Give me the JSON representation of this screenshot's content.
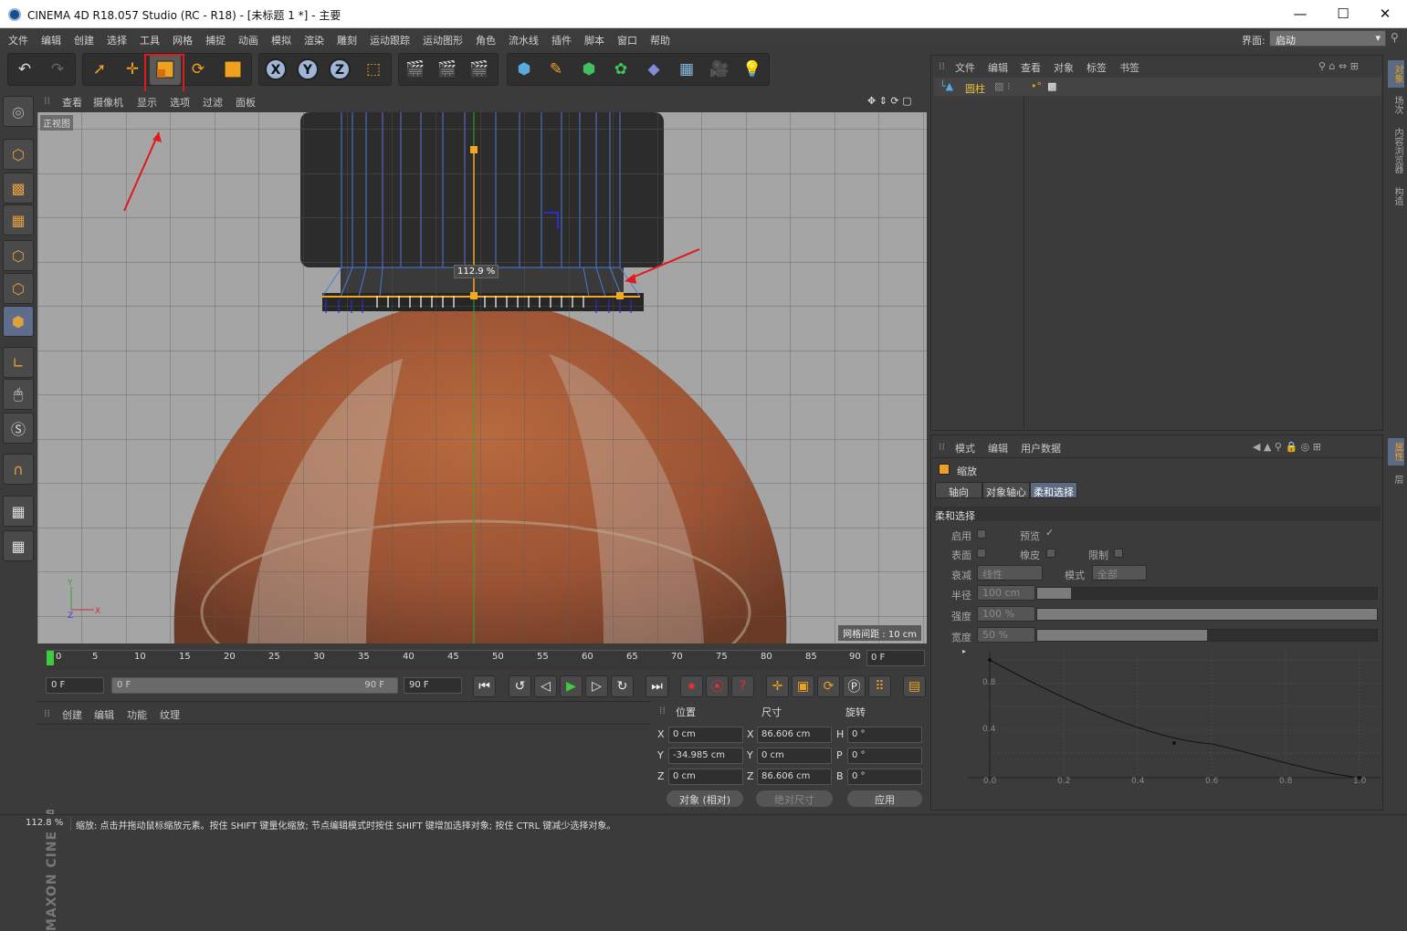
{
  "titlebar": {
    "title": "CINEMA 4D R18.057 Studio (RC - R18) - [未标题 1 *] - 主要",
    "minimize": "—",
    "maximize": "☐",
    "close": "✕"
  },
  "menu": [
    "文件",
    "编辑",
    "创建",
    "选择",
    "工具",
    "网格",
    "捕捉",
    "动画",
    "模拟",
    "渲染",
    "雕刻",
    "运动跟踪",
    "运动图形",
    "角色",
    "流水线",
    "插件",
    "脚本",
    "窗口",
    "帮助"
  ],
  "layout": {
    "label": "界面:",
    "value": "启动"
  },
  "viewport": {
    "menu": [
      "查看",
      "摄像机",
      "显示",
      "选项",
      "过滤",
      "面板"
    ],
    "label": "正视图",
    "scale_readout": "112.9 %",
    "grid_spacing": "网格间距 : 10 cm"
  },
  "timeline": {
    "ticks": [
      "0",
      "5",
      "10",
      "15",
      "20",
      "25",
      "30",
      "35",
      "40",
      "45",
      "50",
      "55",
      "60",
      "65",
      "70",
      "75",
      "80",
      "85",
      "90"
    ],
    "current_frame": "0 F"
  },
  "transport": {
    "start": "0 F",
    "range_start": "0 F",
    "range_end": "90 F",
    "end": "90 F"
  },
  "material_manager": {
    "menu": [
      "创建",
      "编辑",
      "功能",
      "纹理"
    ]
  },
  "coordinates": {
    "headers": [
      "位置",
      "尺寸",
      "旋转"
    ],
    "rows": [
      {
        "axis": "X",
        "pos": "0 cm",
        "size_axis": "X",
        "size": "86.606 cm",
        "rot_axis": "H",
        "rot": "0 °"
      },
      {
        "axis": "Y",
        "pos": "-34.985 cm",
        "size_axis": "Y",
        "size": "0 cm",
        "rot_axis": "P",
        "rot": "0 °"
      },
      {
        "axis": "Z",
        "pos": "0 cm",
        "size_axis": "Z",
        "size": "86.606 cm",
        "rot_axis": "B",
        "rot": "0 °"
      }
    ],
    "mode": "对象 (相对)",
    "size_mode": "绝对尺寸",
    "apply": "应用"
  },
  "object_manager": {
    "menu": [
      "文件",
      "编辑",
      "查看",
      "对象",
      "标签",
      "书签"
    ],
    "object": "圆柱"
  },
  "attribute_manager": {
    "menu": [
      "模式",
      "编辑",
      "用户数据"
    ],
    "tool": "缩放",
    "tabs": [
      "轴向",
      "对象轴心",
      "柔和选择"
    ],
    "section": "柔和选择",
    "enable": "启用",
    "preview": "预览",
    "surface": "表面",
    "rubber": "橡皮",
    "limit": "限制",
    "falloff_label": "衰减",
    "falloff": "线性",
    "mode_label": "模式",
    "mode": "全部",
    "radius_label": "半径",
    "radius": "100 cm",
    "strength_label": "强度",
    "strength": "100 %",
    "width_label": "宽度",
    "width": "50 %",
    "curve_y": [
      "0.8",
      "0.4"
    ],
    "curve_x": [
      "0.0",
      "0.2",
      "0.4",
      "0.6",
      "0.8",
      "1.0"
    ]
  },
  "right_tabs": [
    "对象",
    "场次",
    "内容浏览器",
    "构造"
  ],
  "right_tabs2": [
    "属性",
    "层"
  ],
  "status": {
    "zoom": "112.8 %",
    "message": "缩放: 点击并拖动鼠标缩放元素。按住 SHIFT 键量化缩放; 节点编辑模式时按住 SHIFT 键增加选择对象; 按住 CTRL 键减少选择对象。"
  },
  "brand": "MAXON CINEMA 4D",
  "colors": {
    "accent": "#f5a623",
    "highlight": "#e0191a",
    "active_tab": "#5c6a82"
  }
}
